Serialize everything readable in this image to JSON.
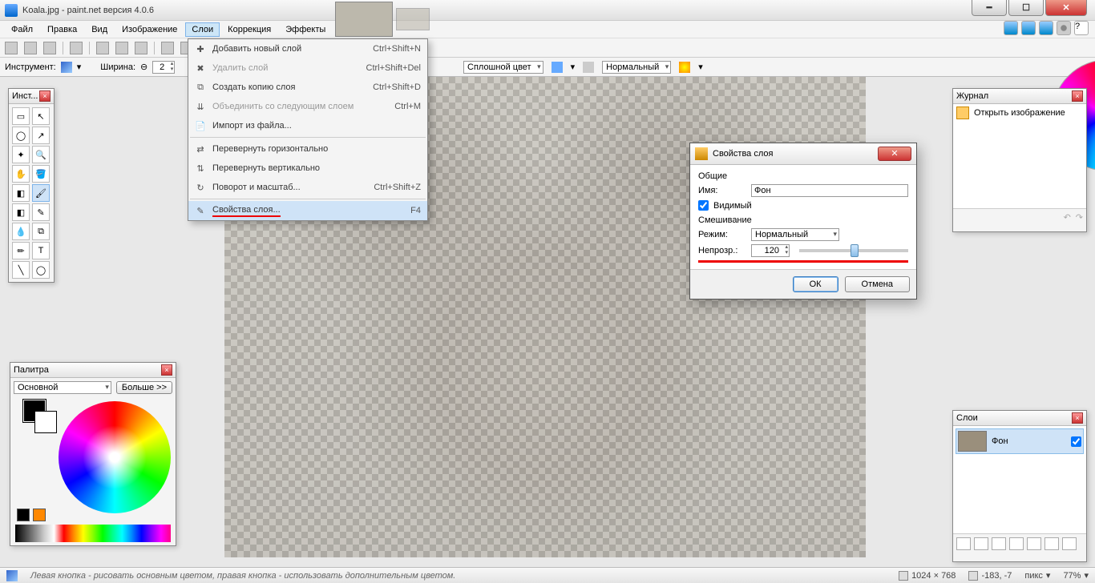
{
  "title": "Koala.jpg - paint.net версия 4.0.6",
  "menus": [
    "Файл",
    "Правка",
    "Вид",
    "Изображение",
    "Слои",
    "Коррекция",
    "Эффекты"
  ],
  "active_menu": "Слои",
  "toolbar3": {
    "instrument_label": "Инструмент:",
    "width_label": "Ширина:",
    "width_value": "2",
    "fill_label": "Сплошной цвет",
    "mode_label": "Нормальный"
  },
  "dropdown": [
    {
      "icon": "✚",
      "label": "Добавить новый слой",
      "shortcut": "Ctrl+Shift+N"
    },
    {
      "icon": "✖",
      "label": "Удалить слой",
      "shortcut": "Ctrl+Shift+Del",
      "disabled": true
    },
    {
      "icon": "⧉",
      "label": "Создать копию слоя",
      "shortcut": "Ctrl+Shift+D"
    },
    {
      "icon": "⇊",
      "label": "Объединить со следующим слоем",
      "shortcut": "Ctrl+M",
      "disabled": true
    },
    {
      "icon": "📄",
      "label": "Импорт из файла...",
      "shortcut": ""
    },
    {
      "sep": true
    },
    {
      "icon": "⇄",
      "label": "Перевернуть горизонтально",
      "shortcut": ""
    },
    {
      "icon": "⇅",
      "label": "Перевернуть вертикально",
      "shortcut": ""
    },
    {
      "icon": "↻",
      "label": "Поворот и масштаб...",
      "shortcut": "Ctrl+Shift+Z"
    },
    {
      "sep": true
    },
    {
      "icon": "✎",
      "label": "Свойства слоя...",
      "shortcut": "F4",
      "hover": true,
      "underline": true
    }
  ],
  "dialog": {
    "title": "Свойства слоя",
    "section_general": "Общие",
    "name_label": "Имя:",
    "name_value": "Фон",
    "visible_label": "Видимый",
    "visible_checked": true,
    "section_blend": "Смешивание",
    "mode_label": "Режим:",
    "mode_value": "Нормальный",
    "opacity_label": "Непрозр.:",
    "opacity_value": "120",
    "ok": "ОК",
    "cancel": "Отмена"
  },
  "panels": {
    "tools_title": "Инст...",
    "colors_title": "Палитра",
    "colors_primary": "Основной",
    "colors_more": "Больше >>",
    "history_title": "Журнал",
    "history_item": "Открыть изображение",
    "layers_title": "Слои",
    "layer_name": "Фон"
  },
  "status": {
    "hint": "Левая кнопка - рисовать основным цветом, правая кнопка - использовать дополнительным цветом.",
    "dimensions": "1024 × 768",
    "cursor": "-183, -7",
    "units": "пикс",
    "zoom": "77%"
  }
}
